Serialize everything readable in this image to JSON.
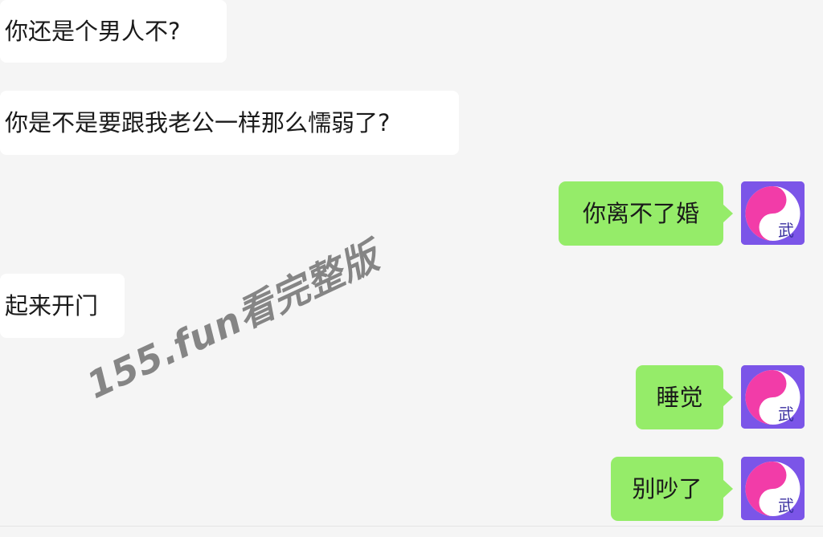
{
  "messages": [
    {
      "side": "left",
      "text": "你还是个男人不?"
    },
    {
      "side": "left",
      "text": "你是不是要跟我老公一样那么懦弱了?"
    },
    {
      "side": "right",
      "text": "你离不了婚"
    },
    {
      "side": "left",
      "text": "起来开门"
    },
    {
      "side": "right",
      "text": "睡觉"
    },
    {
      "side": "right",
      "text": "别吵了"
    }
  ],
  "avatar": {
    "glyph": "武"
  },
  "watermark": {
    "text": "155.fun看完整版"
  },
  "colors": {
    "background": "#f5f5f5",
    "incoming_bubble": "#ffffff",
    "outgoing_bubble": "#95ec69",
    "avatar_bg": "#7b55e8",
    "avatar_accent": "#f23ca8"
  }
}
